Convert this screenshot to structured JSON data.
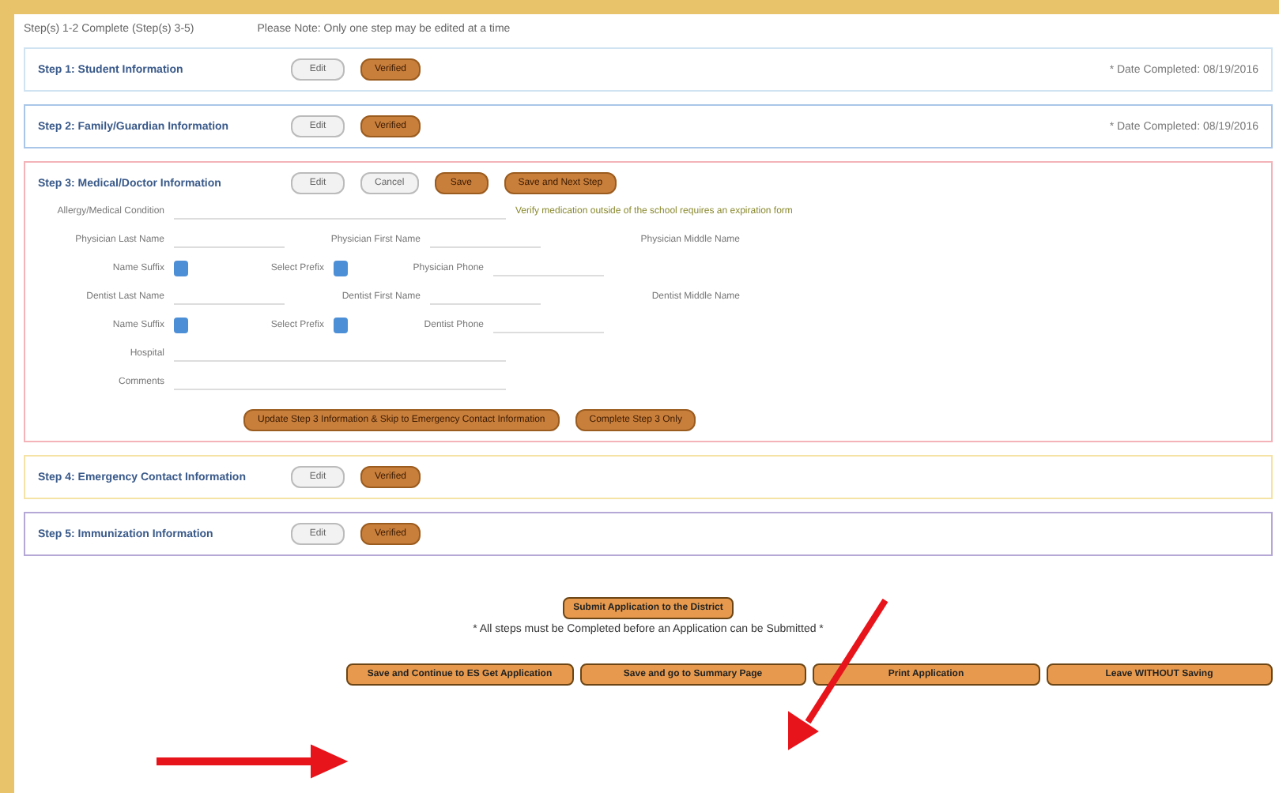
{
  "header": {
    "status": "Step(s) 1-2 Complete (Step(s) 3-5)",
    "note": "Please Note: Only one step may be edited at a time"
  },
  "steps": [
    {
      "title": "Step 1: Student Information",
      "color": "#cfe3f2",
      "buttons": [
        {
          "label": "Edit",
          "kind": "plain"
        },
        {
          "label": "Verified",
          "kind": "orange"
        }
      ],
      "date": "* Date Completed: 08/19/2016"
    },
    {
      "title": "Step 2: Family/Guardian Information",
      "color": "#a9c6e8",
      "buttons": [
        {
          "label": "Edit",
          "kind": "plain"
        },
        {
          "label": "Verified",
          "kind": "orange"
        }
      ],
      "date": "* Date Completed: 08/19/2016"
    },
    {
      "title": "Step 3: Medical/Doctor Information",
      "color": "#f3b3b8",
      "buttons": [
        {
          "label": "Edit",
          "kind": "plain"
        },
        {
          "label": "Cancel",
          "kind": "plain"
        },
        {
          "label": "Save",
          "kind": "orange"
        },
        {
          "label": "Save and Next Step",
          "kind": "orange"
        }
      ],
      "form": {
        "rows": [
          [
            {
              "label": "Allergy/Medical Condition",
              "kind": "field",
              "wide": true
            },
            {
              "label": "Verify medication outside of the school requires an expiration form",
              "kind": "note"
            }
          ],
          [
            {
              "label": "Physician Last Name",
              "kind": "field"
            },
            {
              "label": "Physician First Name",
              "kind": "field"
            },
            {
              "label": "Physician Middle Name",
              "kind": "text"
            }
          ],
          [
            {
              "label": "Name Suffix",
              "kind": "select"
            },
            {
              "label": "Select Prefix",
              "kind": "select"
            },
            {
              "label": "Physician Phone",
              "kind": "field"
            }
          ],
          [
            {
              "label": "Dentist Last Name",
              "kind": "field"
            },
            {
              "label": "Dentist First Name",
              "kind": "field"
            },
            {
              "label": "Dentist Middle Name",
              "kind": "text"
            }
          ],
          [
            {
              "label": "Name Suffix",
              "kind": "select"
            },
            {
              "label": "Select Prefix",
              "kind": "select"
            },
            {
              "label": "Dentist Phone",
              "kind": "field"
            }
          ],
          [
            {
              "label": "Hospital",
              "kind": "field",
              "wide": true
            }
          ],
          [
            {
              "label": "Comments",
              "kind": "field",
              "wide": true
            }
          ]
        ],
        "actions": [
          "Update Step 3 Information & Skip to Emergency Contact Information",
          "Complete Step 3 Only"
        ]
      }
    },
    {
      "title": "Step 4: Emergency Contact Information",
      "color": "#f5e3a6",
      "buttons": [
        {
          "label": "Edit",
          "kind": "plain"
        },
        {
          "label": "Verified",
          "kind": "orange"
        }
      ]
    },
    {
      "title": "Step 5: Immunization Information",
      "color": "#b6a8d6",
      "buttons": [
        {
          "label": "Edit",
          "kind": "plain"
        },
        {
          "label": "Verified",
          "kind": "orange"
        }
      ]
    }
  ],
  "submit": {
    "label": "Submit Application to the District",
    "note": "* All steps must be Completed before an Application can be Submitted *"
  },
  "footer_buttons": [
    "Save and Continue to ES Get Application",
    "Save and go to Summary Page",
    "Print Application",
    "Leave WITHOUT Saving"
  ]
}
